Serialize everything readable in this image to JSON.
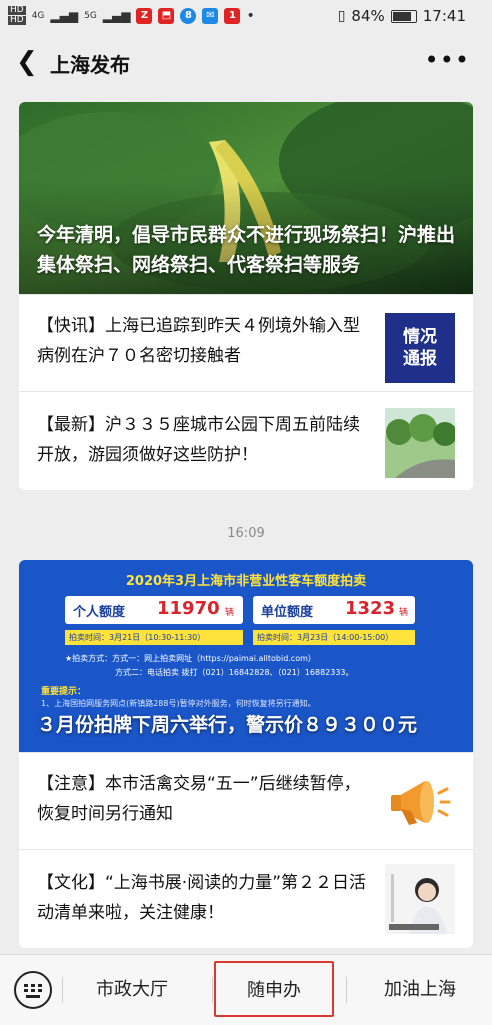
{
  "statusbar": {
    "hd1": "HD",
    "hd2": "HD",
    "net1": "4G",
    "net2": "5G",
    "battery": "84%",
    "time": "17:41",
    "app_icon_colors": [
      "#e02424",
      "#e02424",
      "#1e88e5",
      "#1e88e5",
      "#e02424"
    ]
  },
  "navbar": {
    "title": "上海发布"
  },
  "group1": {
    "hero_title": "今年清明，倡导市民群众不进行现场祭扫！沪推出集体祭扫、网络祭扫、代客祭扫等服务",
    "items": [
      {
        "text": "【快讯】上海已追踪到昨天４例境外输入型病例在沪７０名密切接触者",
        "thumb_text": "情况通报"
      },
      {
        "text": "【最新】沪３３５座城市公园下周五前陆续开放，游园须做好这些防护！"
      }
    ]
  },
  "timestamp": "16:09",
  "group2": {
    "poster": {
      "heading": "2020年3月上海市非营业性客车额度拍卖",
      "personal_label": "个人额度",
      "personal_value": "11970",
      "personal_unit": "辆",
      "company_label": "单位额度",
      "company_value": "1323",
      "company_unit": "辆",
      "personal_time": "拍卖时间：3月21日（10:30-11:30）",
      "company_time": "拍卖时间：3月23日（14:00-15:00）",
      "method1": "★拍卖方式：方式一：网上拍卖网址（https://paimai.alltobid.com）",
      "method2": "方式二：电话拍卖 拨打（021）16842828、（021）16882333。",
      "notice_title": "重要提示：",
      "notice1": "1、上海国拍网服务网点(新镇路288号)暂停对外服务，何时恢复将另行通知。"
    },
    "hero_title": "３月份拍牌下周六举行，警示价８９３００元",
    "items": [
      {
        "text": "【注意】本市活禽交易“五一”后继续暂停，恢复时间另行通知"
      },
      {
        "text": "【文化】“上海书展·阅读的力量”第２２日活动清单来啦，关注健康！"
      }
    ]
  },
  "tabbar": {
    "tabs": [
      "市政大厅",
      "随申办",
      "加油上海"
    ]
  }
}
